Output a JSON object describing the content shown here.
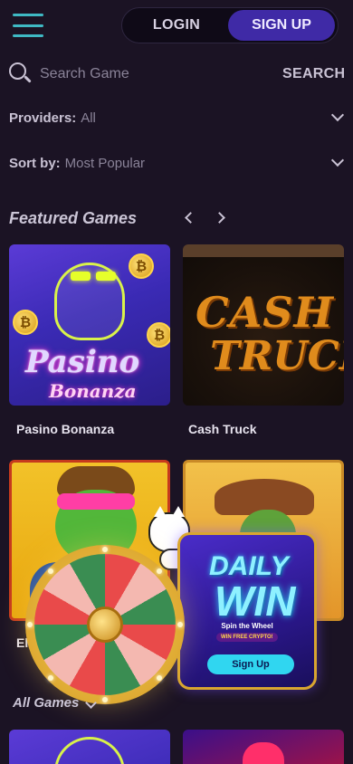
{
  "header": {
    "login_label": "LOGIN",
    "signup_label": "SIGN UP"
  },
  "search": {
    "placeholder": "Search Game",
    "button_label": "SEARCH"
  },
  "filters": {
    "providers": {
      "label": "Providers:",
      "value": "All"
    },
    "sort": {
      "label": "Sort by:",
      "value": "Most Popular"
    }
  },
  "featured": {
    "title": "Featured Games",
    "games": [
      {
        "name": "Pasino Bonanza",
        "art_title_1": "Pasino",
        "art_title_2": "Bonanza"
      },
      {
        "name": "Cash Truck",
        "art_title_1": "CASH",
        "art_title_2": "TRUCK"
      },
      {
        "name": "El",
        "art_title_1": ""
      },
      {
        "name": "",
        "art_title_1": ""
      }
    ]
  },
  "promo": {
    "title_line1": "DAILY",
    "title_line2": "WIN",
    "subtitle": "Spin the Wheel",
    "tagline": "WIN FREE CRYPTO!",
    "cta_label": "Sign Up",
    "accent_color": "#30d6f0",
    "frame_color": "#d9a630"
  },
  "all_games": {
    "title": "All Games"
  },
  "icons": {
    "menu": "hamburger-menu-icon",
    "search": "search-icon",
    "chevron": "chevron-down-icon",
    "prev": "chevron-left-icon",
    "next": "chevron-right-icon"
  },
  "colors": {
    "background": "#1b1324",
    "brand_primary": "#3f2aa6",
    "accent": "#3fb9c4"
  }
}
